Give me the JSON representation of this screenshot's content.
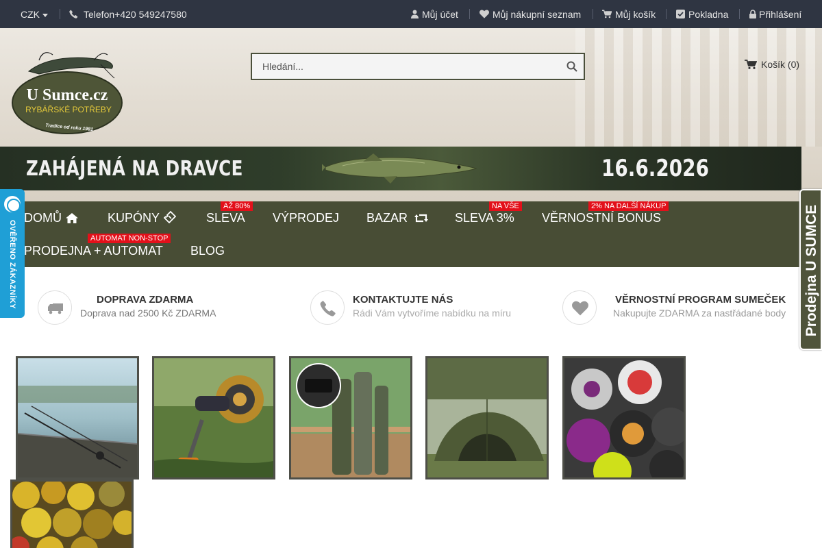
{
  "topbar": {
    "currency": "CZK",
    "phone": "Telefon+420 549247580",
    "account": "Můj účet",
    "wishlist": "Můj nákupní seznam",
    "cart": "Můj košík",
    "checkout": "Pokladna",
    "login": "Přihlášení"
  },
  "header": {
    "logo": {
      "name": "U Sumce.cz",
      "tagline": "RYBÁŘSKÉ POTŘEBY",
      "since": "Tradice od roku 1981"
    },
    "search_placeholder": "Hledání...",
    "cart_label": "Košík (0)"
  },
  "banner": {
    "left_text": "ZAHÁJENÁ NA DRAVCE",
    "right_text": "16.6.2026"
  },
  "nav": {
    "items": [
      {
        "label": "DOMŮ",
        "badge": ""
      },
      {
        "label": "KUPÓNY",
        "badge": ""
      },
      {
        "label": "SLEVA",
        "badge": "AŽ 80%"
      },
      {
        "label": "VÝPRODEJ",
        "badge": ""
      },
      {
        "label": "BAZAR",
        "badge": ""
      },
      {
        "label": "SLEVA 3%",
        "badge": "NA VŠE"
      },
      {
        "label": "VĚRNOSTNÍ BONUS",
        "badge": "2% NA DALŠÍ NÁKUP"
      },
      {
        "label": "PRODEJNA + AUTOMAT",
        "badge": "AUTOMAT NON-STOP"
      },
      {
        "label": "BLOG",
        "badge": ""
      }
    ]
  },
  "side": {
    "left_badge": "OVĚŘENO ZÁKAZNÍKY",
    "right_badge": "Prodejna U SUMCE"
  },
  "features": [
    {
      "title": "DOPRAVA ZDARMA",
      "subtitle": "Doprava nad 2500 Kč ZDARMA",
      "icon": "truck-icon"
    },
    {
      "title": "KONTAKTUJTE NÁS",
      "subtitle": "Rádi Vám vytvoříme nabídku na míru",
      "icon": "phone-icon"
    },
    {
      "title": "VĚRNOSTNÍ PROGRAM SUMEČEK",
      "subtitle": "Nakupujte ZDARMA za nastřádané body",
      "icon": "heart-icon"
    }
  ],
  "colors": {
    "topbar": "#2f3542",
    "nav": "#484d35",
    "badge": "#e3101a",
    "left_badge": "#1f9fd6"
  }
}
